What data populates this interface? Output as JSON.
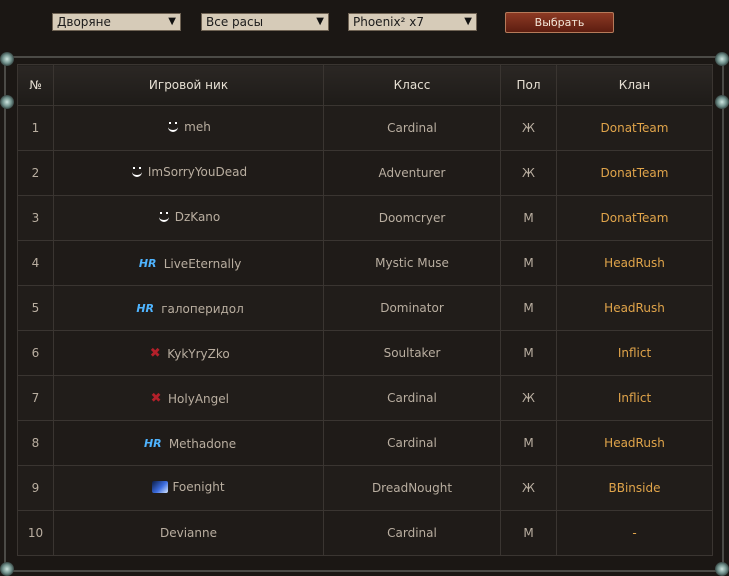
{
  "filters": {
    "class_group": "Дворяне",
    "race": "Все расы",
    "server": "Phoenix² x7",
    "submit_label": "Выбрать",
    "arrow": "▼"
  },
  "table": {
    "headers": [
      "№",
      "Игровой ник",
      "Класс",
      "Пол",
      "Клан"
    ],
    "rows": [
      {
        "num": "1",
        "nick": "meh",
        "icon": "smile-icon",
        "class": "Cardinal",
        "sex": "Ж",
        "clan": "DonatTeam"
      },
      {
        "num": "2",
        "nick": "ImSorryYouDead",
        "icon": "smile-icon",
        "class": "Adventurer",
        "sex": "Ж",
        "clan": "DonatTeam"
      },
      {
        "num": "3",
        "nick": "DzKano",
        "icon": "smile-icon",
        "class": "Doomcryer",
        "sex": "М",
        "clan": "DonatTeam"
      },
      {
        "num": "4",
        "nick": "LiveEternally",
        "icon": "hr-icon",
        "class": "Mystic Muse",
        "sex": "М",
        "clan": "HeadRush"
      },
      {
        "num": "5",
        "nick": "галоперидол",
        "icon": "hr-icon",
        "class": "Dominator",
        "sex": "М",
        "clan": "HeadRush"
      },
      {
        "num": "6",
        "nick": "KykYryZko",
        "icon": "x-icon",
        "class": "Soultaker",
        "sex": "М",
        "clan": "Inflict"
      },
      {
        "num": "7",
        "nick": "HolyAngel",
        "icon": "x-icon",
        "class": "Cardinal",
        "sex": "Ж",
        "clan": "Inflict"
      },
      {
        "num": "8",
        "nick": "Methadone",
        "icon": "hr-icon",
        "class": "Cardinal",
        "sex": "М",
        "clan": "HeadRush"
      },
      {
        "num": "9",
        "nick": "Foenight",
        "icon": "comet-icon",
        "class": "DreadNought",
        "sex": "Ж",
        "clan": "BBinside"
      },
      {
        "num": "10",
        "nick": "Devianne",
        "icon": "",
        "class": "Cardinal",
        "sex": "М",
        "clan": "-"
      }
    ]
  },
  "icon_glyphs": {
    "hr": "HR",
    "x": "✖"
  },
  "colors": {
    "clan_text": "#e0a44a",
    "button": "#8c3a24"
  }
}
